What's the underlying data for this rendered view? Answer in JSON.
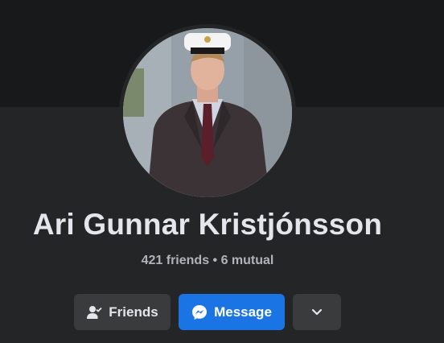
{
  "profile": {
    "name": "Ari Gunnar Kristjónsson",
    "friends_line": "421 friends • 6 mutual",
    "avatar_icon": "profile-photo"
  },
  "actions": {
    "friends_label": "Friends",
    "message_label": "Message",
    "more_icon": "chevron-down-icon"
  },
  "colors": {
    "background": "#242526",
    "cover": "#18191a",
    "primary_button": "#1b74e4",
    "secondary_button": "#3a3b3c",
    "name_text": "#e4e6eb",
    "meta_text": "#b0b3b8"
  }
}
